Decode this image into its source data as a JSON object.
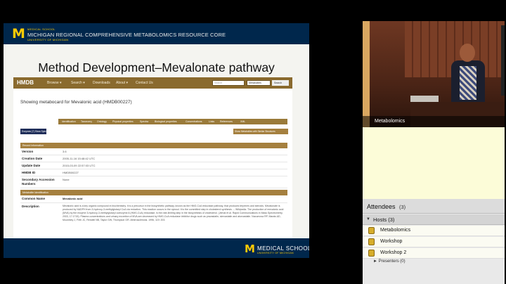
{
  "slide": {
    "header": {
      "logo": "M",
      "line_small_top": "MEDICAL SCHOOL",
      "title": "MICHIGAN REGIONAL COMPREHENSIVE METABOLOMICS RESOURCE CORE",
      "line_small_bottom": "UNIVERSITY OF MICHIGAN"
    },
    "title": "Method Development–Mevalonate pathway",
    "footer": {
      "logo": "M",
      "school": "MEDICAL SCHOOL",
      "university": "UNIVERSITY OF MICHIGAN"
    },
    "hmdb": {
      "logo": "HMDB",
      "nav": [
        "Browse ▾",
        "Search ▾",
        "Downloads",
        "About ▾",
        "Contact Us"
      ],
      "search_placeholder": "Search",
      "search_select": "Metabolites",
      "search_button": "Search",
      "metabocard_title": "Showing metabocard for Mevalonic acid (HMDB00227)",
      "tabs": [
        "Identification",
        "Taxonomy",
        "Ontology",
        "Physical properties",
        "Spectra",
        "Biological properties",
        "Concentrations",
        "Links",
        "References",
        "XML"
      ],
      "enzymes_button": "Enzymes (7)  Show Spectra",
      "show_metabolites_button": "Show Metabolites with Similar Structures",
      "section_record": "Record Information",
      "section_identification": "Metabolite Identification",
      "rows": [
        {
          "label": "Version",
          "value": "3.6"
        },
        {
          "label": "Creation Date",
          "value": "2005-11-16 15:48:42 UTC"
        },
        {
          "label": "Update Date",
          "value": "2015-03-09 22:57:03 UTC"
        },
        {
          "label": "HMDB ID",
          "value": "HMDB00227"
        },
        {
          "label": "Secondary Accession Numbers",
          "value": "None"
        }
      ],
      "common_name_label": "Common Name",
      "common_name_value": "Mevalonic acid",
      "description_label": "Description",
      "description_value": "Mevalonic acid is a key organic compound in biochemistry. It is a precursor in the biosynthetic pathway, known as the HMG-CoA reductase pathway, that produces terpenes and steroids. Mevalonate is produced by NADPH from 3-hydroxy-3-methylglutaryl CoA via reduction. This reaction occurs in the cytosol. It is the committed step in cholesterol synthesis. -- Wikipedia. The production of mevalonic acid (MVA) by the enzyme 3-hydroxy-3-methylglutaryl coenzyme A (HMG-CoA) reductase, is the rate-limiting step in the biosynthesis of cholesterol. (Jemal et al. Rapid Communications in Mass Spectrometry, 2003, 17:1715). Plasma concentrations and urinary excretion of MVA are decreased by HMG-CoA reductase inhibitor drugs such as pravastatin, simvastatin and atorvastatin. Naoumova RP, Marais AD, Mountney J, Firth JC, Rendell NB, Taylor GW, Thompson GR. Atherosclerosis. 1996, 119: 203."
    }
  },
  "video": {
    "caption": "Metabolomics"
  },
  "attendees": {
    "title": "Attendees",
    "count": "(3)",
    "hosts_toggle": "▼",
    "hosts_title": "Hosts (3)",
    "hosts": [
      "Metabolomics",
      "Workshop",
      "Workshop 2"
    ],
    "presenters_label": "► Presenters (0)"
  },
  "colors": {
    "um_blue": "#00274c",
    "um_maize": "#ffcb05",
    "hmdb_brown": "#8a6a2e",
    "chat_bg": "#fcfcd8"
  },
  "icons": {
    "host_icon": "host-lock-icon",
    "toggle": "chevron-down-icon"
  }
}
